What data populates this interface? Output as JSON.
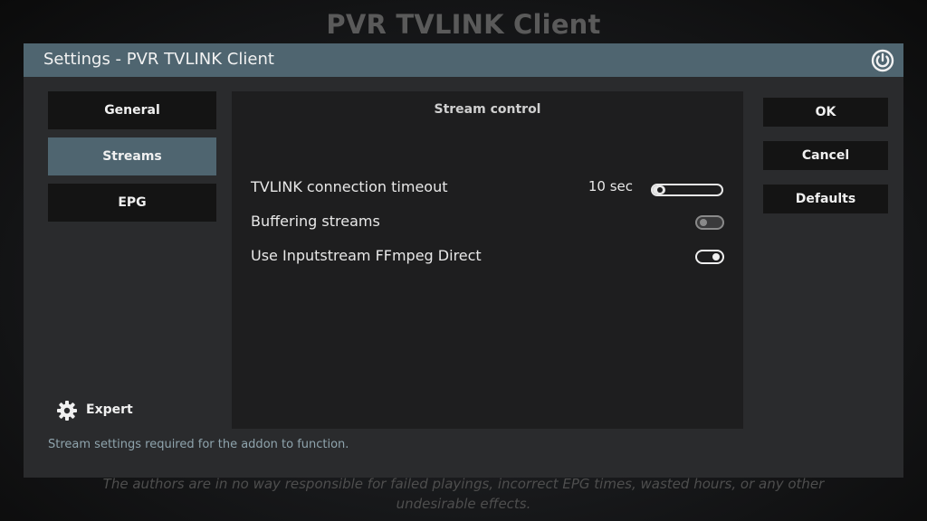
{
  "background": {
    "title": "PVR TVLINK Client",
    "disclaimer": "The authors are in no way responsible for failed playings, incorrect EPG times, wasted hours, or any other undesirable effects."
  },
  "dialog": {
    "title": "Settings - PVR TVLINK Client",
    "close_icon": "power-icon"
  },
  "categories": [
    {
      "label": "General",
      "active": false
    },
    {
      "label": "Streams",
      "active": true
    },
    {
      "label": "EPG",
      "active": false
    }
  ],
  "content": {
    "section_title": "Stream control",
    "settings": [
      {
        "label": "TVLINK connection timeout",
        "value": "10 sec",
        "control": "slider",
        "level": 0.05
      },
      {
        "label": "Buffering streams",
        "control": "toggle",
        "enabled": false
      },
      {
        "label": "Use Inputstream FFmpeg Direct",
        "control": "toggle",
        "enabled": true
      }
    ]
  },
  "actions": {
    "ok": "OK",
    "cancel": "Cancel",
    "defaults": "Defaults"
  },
  "expert": {
    "label": "Expert",
    "icon": "gear-icon"
  },
  "help_text": "Stream settings required for the addon to function.",
  "colors": {
    "accent": "#4f6570",
    "dialog_bg": "#2a2b2d",
    "button_bg": "#141414"
  }
}
